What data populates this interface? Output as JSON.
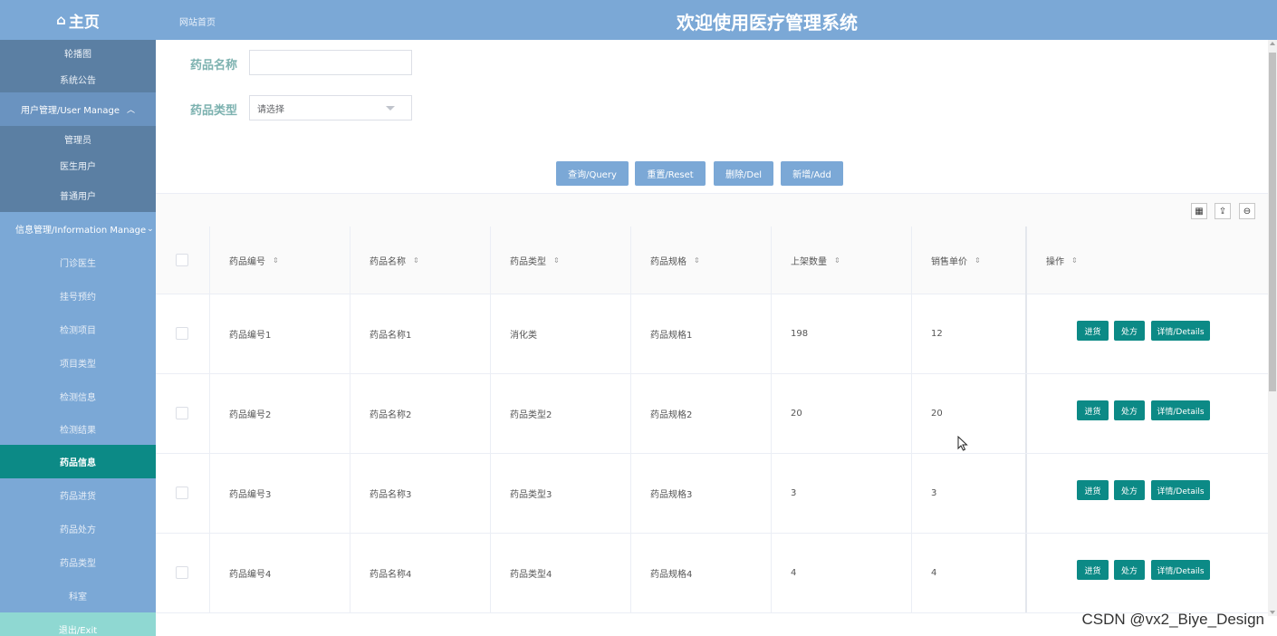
{
  "header": {
    "home_label": "主页",
    "site_link": "网站首页",
    "title": "欢迎使用医疗管理系统"
  },
  "sidebar": {
    "items": [
      {
        "label": "轮播图"
      },
      {
        "label": "系统公告"
      },
      {
        "label": "用户管理/User Manage"
      },
      {
        "label": "管理员"
      },
      {
        "label": "医生用户"
      },
      {
        "label": "普通用户"
      },
      {
        "label": "信息管理/Information Manage"
      },
      {
        "label": "门诊医生"
      },
      {
        "label": "挂号预约"
      },
      {
        "label": "检测项目"
      },
      {
        "label": "项目类型"
      },
      {
        "label": "检测信息"
      },
      {
        "label": "检测结果"
      },
      {
        "label": "药品信息"
      },
      {
        "label": "药品进货"
      },
      {
        "label": "药品处方"
      },
      {
        "label": "药品类型"
      },
      {
        "label": "科室"
      },
      {
        "label": "退出/Exit"
      }
    ]
  },
  "search": {
    "name_label": "药品名称",
    "name_value": "",
    "type_label": "药品类型",
    "type_value": "请选择"
  },
  "buttons": {
    "query": "查询/Query",
    "reset": "重置/Reset",
    "delete": "删除/Del",
    "add": "新增/Add"
  },
  "table": {
    "columns": [
      "药品编号",
      "药品名称",
      "药品类型",
      "药品规格",
      "上架数量",
      "销售单价",
      "操作"
    ],
    "rows": [
      {
        "code": "药品编号1",
        "name": "药品名称1",
        "type": "消化类",
        "spec": "药品规格1",
        "qty": "198",
        "price": "12"
      },
      {
        "code": "药品编号2",
        "name": "药品名称2",
        "type": "药品类型2",
        "spec": "药品规格2",
        "qty": "20",
        "price": "20"
      },
      {
        "code": "药品编号3",
        "name": "药品名称3",
        "type": "药品类型3",
        "spec": "药品规格3",
        "qty": "3",
        "price": "3"
      },
      {
        "code": "药品编号4",
        "name": "药品名称4",
        "type": "药品类型4",
        "spec": "药品规格4",
        "qty": "4",
        "price": "4"
      }
    ],
    "actions": {
      "stock": "进货",
      "prescription": "处方",
      "details": "详情/Details"
    }
  },
  "watermark": "CSDN @vx2_Biye_Design",
  "colors": {
    "header": "#7ba8d6",
    "active": "#0c8a86",
    "sidebar_sub": "#5b7fa3"
  }
}
